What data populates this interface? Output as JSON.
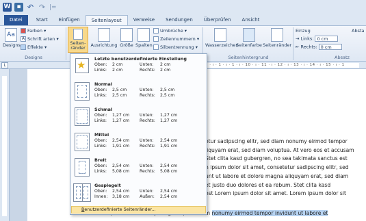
{
  "quick_access": {
    "word_icon": "W",
    "redo_hint": "↷",
    "sep": "|="
  },
  "tabs": [
    "Datei",
    "Start",
    "Einfügen",
    "Seitenlayout",
    "Verweise",
    "Sendungen",
    "Überprüfen",
    "Ansicht"
  ],
  "active_tab": "Seitenlayout",
  "ribbon": {
    "designs_group": {
      "label": "Designs",
      "designs_btn": "Designs",
      "farben": "Farben",
      "schriftarten": "Schrift arten",
      "effekte": "Effekte"
    },
    "page_setup": {
      "seitenraender_line1": "Seiten-",
      "seitenraender_line2": "ränder",
      "ausrichtung": "Ausrichtung",
      "groesse": "Größe",
      "spalten": "Spalten",
      "umbrueche": "Umbrüche",
      "zeilennummern": "Zeilennummern",
      "silbentrennung": "Silbentrennung"
    },
    "page_background": {
      "label": "Seitenhintergrund",
      "wasserzeichen": "Wasserzeichen",
      "seitenfarbe": "Seitenfarbe",
      "seitenraender": "Seitenränder"
    },
    "paragraph": {
      "einzug": "Einzug",
      "links_label": "Links:",
      "links_value": "0 cm",
      "rechts_label": "Rechts:",
      "rechts_value": "0 cm",
      "absatz": "Absatz",
      "abst": "Absta"
    }
  },
  "ruler_marks": "2 · ı · 1 · ı · 1 · ı · 10 · ı · 11 · ı · 12 · ı · 13 · ı · 14 · ı · 15 · ı · 1",
  "margins_menu": {
    "items": [
      {
        "title": "Letzte benutzerdefinierte Einstellung",
        "oben": "2 cm",
        "links": "2 cm",
        "unten": "2 cm",
        "rechts": "2 cm"
      },
      {
        "title": "Normal",
        "oben": "2,5 cm",
        "links": "2,5 cm",
        "unten": "2,5 cm",
        "rechts": "2,5 cm"
      },
      {
        "title": "Schmal",
        "oben": "1,27 cm",
        "links": "1,27 cm",
        "unten": "1,27 cm",
        "rechts": "1,27 cm"
      },
      {
        "title": "Mittel",
        "oben": "2,54 cm",
        "links": "1,91 cm",
        "unten": "2,54 cm",
        "rechts": "1,91 cm"
      },
      {
        "title": "Breit",
        "oben": "2,54 cm",
        "links": "5,08 cm",
        "unten": "2,54 cm",
        "rechts": "5,08 cm"
      },
      {
        "title": "Gespiegelt",
        "oben": "2,54 cm",
        "innen": "3,18 cm",
        "unten": "2,54 cm",
        "aussen": "2,54 cm"
      }
    ],
    "labels": {
      "oben": "Oben:",
      "links": "Links:",
      "unten": "Unten:",
      "rechts": "Rechts:",
      "innen": "Innen:",
      "aussen": "Außen:"
    },
    "footer_underlined": "B",
    "footer_rest": "enutzerdefinierte Seitenränder..."
  },
  "document": {
    "lines": [
      "etur sadipscing elitr, sed diam nonumy eirmod tempor",
      "liquyam erat, sed diam voluptua. At vero eos et accusam",
      "Stet clita kasd gubergren, no sea takimata sanctus est",
      "n ipsum dolor sit amet, consetetur sadipscing elitr, sed",
      "unt ut labore et dolore magna aliquyam erat, sed diam",
      "sto duo dolores et ea rebum. Stet clita kasd",
      "est Lorem ipsum dolor sit amet. Lorem ipsum dolor sit"
    ],
    "line6_prefix": "et justo duo dolores et ea rebum. Stet clita kasd",
    "last_plain": "amet, consetetur sadipscing elitr, sed diam ",
    "last_highlight": "nonumy eirmod tempor invidunt ut labore et"
  }
}
